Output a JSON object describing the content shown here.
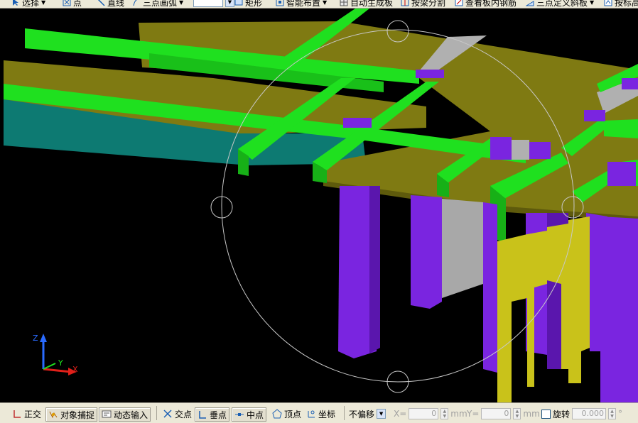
{
  "toolbar": {
    "items": [
      {
        "label": "选择",
        "icon": "cursor-icon"
      },
      {
        "label": "点",
        "icon": "point-icon"
      },
      {
        "label": "直线",
        "icon": "line-icon"
      },
      {
        "label": "三点画弧",
        "icon": "arc-icon"
      },
      {
        "label": "矩形",
        "icon": "rectangle-icon"
      },
      {
        "label": "智能布置",
        "icon": "smart-layout-icon"
      },
      {
        "label": "自动生成板",
        "icon": "auto-slab-icon"
      },
      {
        "label": "按梁分割",
        "icon": "split-by-beam-icon"
      },
      {
        "label": "查看板内钢筋",
        "icon": "view-rebar-icon"
      },
      {
        "label": "三点定义斜板",
        "icon": "sloped-slab-icon"
      },
      {
        "label": "按标高",
        "icon": "by-elevation-icon"
      }
    ]
  },
  "viewport": {
    "axes": {
      "z": "Z",
      "y": "Y",
      "x": "X"
    },
    "colors": {
      "background": "#000000",
      "slab": "#7f7a12",
      "beam": "#1fe01f",
      "column": "#6a1fd0",
      "wall": "#a8a8a8",
      "teal_slab": "#0d7a72",
      "yellow_column": "#c9c21a"
    }
  },
  "statusbar": {
    "ortho": "正交",
    "osnap": "对象捕捉",
    "dynamic_input": "动态输入",
    "intersection": "交点",
    "perpendicular": "垂点",
    "midpoint": "中点",
    "vertex": "顶点",
    "coordinate": "坐标",
    "offset_mode": "不偏移",
    "x_label": "X=",
    "x_value": "0",
    "x_unit": "mm",
    "y_label": "Y=",
    "y_value": "0",
    "y_unit": "mm",
    "rotate_label": "旋转",
    "rotate_value": "0.000",
    "rotate_unit": "°"
  }
}
